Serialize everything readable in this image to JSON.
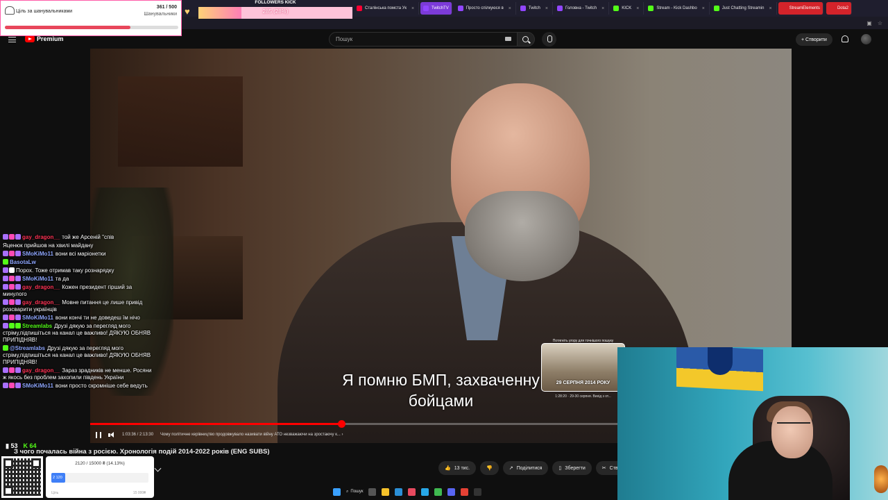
{
  "browser": {
    "tabs": [
      {
        "label": "Сталінська помста Ук",
        "color": "#f03"
      },
      {
        "label": "TwitchTV",
        "color": "#9146ff",
        "style": "badge-purple"
      },
      {
        "label": "Просто спілкуюся в",
        "color": "#9146ff"
      },
      {
        "label": "Twitch",
        "color": "#9146ff"
      },
      {
        "label": "Головна - Twitch",
        "color": "#9146ff"
      },
      {
        "label": "KICK",
        "color": "#53fc18"
      },
      {
        "label": "Stream - Kick Dashbo",
        "color": "#53fc18"
      },
      {
        "label": "Just Chatting Streamin",
        "color": "#53fc18"
      },
      {
        "label": "StreamElements",
        "color": "#d3232a",
        "style": "badge-red"
      },
      {
        "label": "Dota2",
        "color": "#d3232a",
        "style": "badge-red"
      }
    ]
  },
  "header": {
    "logo_text": "Premium",
    "search_placeholder": "Пошук",
    "create_label": "+ Створити"
  },
  "player": {
    "subtitle_line1": "Я помню БМП, захваченну",
    "subtitle_line2": "бойцами",
    "time": "1:03:36 / 2:13:30",
    "chapter": "Чому політичне керівництво продовжувало називати війну АТО незважаючи на зростаючу к... ›",
    "progress_percent": 47.6,
    "preview_hint": "Потягніть угору для точнішого пошуку",
    "preview_overlay": "29 СЕРПНЯ 2014 РОКУ",
    "preview_caption": "1:28:20 · 29-30 серпня. Вихід з от..."
  },
  "video": {
    "title": "З чого почалась війна з росією. Хронологія подій 2014-2022 років (ENG SUBS)",
    "like_count": "13 тис.",
    "share_label": "Поділитися",
    "save_label": "Зберегти",
    "clip_label": "Створи"
  },
  "chat": [
    {
      "user": "gay_dragon__",
      "color": "#ff3355",
      "text": "той же Арсеній \"спів",
      "badges": [
        "#a970ff",
        "#ff49b4",
        "#a970ff"
      ]
    },
    {
      "user": "",
      "color": "#ffffff",
      "text": "Яценюк прийшов на хвилі майдану",
      "badges": []
    },
    {
      "user": "SMoKiMo11",
      "color": "#8fa7ff",
      "text": "вони всі маріонетки",
      "badges": [
        "#a970ff",
        "#ff49b4",
        "#a970ff"
      ]
    },
    {
      "user": "BasotaLw",
      "color": "#8fa7ff",
      "text": "",
      "badges": [
        "#53fc18"
      ]
    },
    {
      "user": "",
      "color": "#3c3cff",
      "text": "Порох. Тоже отримав таку рознарядку",
      "badges": [
        "#a970ff",
        "#ffffff"
      ]
    },
    {
      "user": "SMoKiMo11",
      "color": "#8fa7ff",
      "text": "та да",
      "badges": [
        "#a970ff",
        "#ff49b4",
        "#a970ff"
      ]
    },
    {
      "user": "gay_dragon__",
      "color": "#ff3355",
      "text": "Кожен президент гірший за минулого",
      "badges": [
        "#a970ff",
        "#ff49b4",
        "#a970ff"
      ]
    },
    {
      "user": "gay_dragon__",
      "color": "#ff3355",
      "text": "Мовне питання це лише привід розсварити українців",
      "badges": [
        "#a970ff",
        "#ff49b4",
        "#a970ff"
      ]
    },
    {
      "user": "SMoKiMo11",
      "color": "#8fa7ff",
      "text": "вони кончі ти не доведеш їм нічо",
      "badges": [
        "#a970ff",
        "#ff49b4",
        "#a970ff"
      ]
    },
    {
      "user": "Streamlabs",
      "color": "#53fc18",
      "text": "Друзі дякую за перегляд мого стріму,підпишіться на канал це важливо! ДЯКУЮ ОБНЯВ ПРИПІДНЯВ!",
      "badges": [
        "#a970ff",
        "#53fc18",
        "#53fc18"
      ]
    },
    {
      "user": "@Streamlabs",
      "color": "#8fa7ff",
      "text": "Друзі дякую за перегляд мого стріму,підпишіться на канал це важливо! ДЯКУЮ ОБНЯВ ПРИПІДНЯВ!",
      "badges": [
        "#53fc18"
      ]
    },
    {
      "user": "gay_dragon__",
      "color": "#ff3355",
      "text": "Зараз зрадників не менше. Росяни ж якось без проблем захопили південь України",
      "badges": [
        "#a970ff",
        "#ff49b4",
        "#a970ff"
      ]
    },
    {
      "user": "SMoKiMo11",
      "color": "#8fa7ff",
      "text": "вони просто скромніше себе ведуть",
      "badges": [
        "#a970ff",
        "#ff49b4",
        "#a970ff"
      ]
    }
  ],
  "stats": {
    "twitch_viewers": "53",
    "kick_viewers": "64"
  },
  "follower_goal": {
    "label": "Ціль за шанувальниками",
    "count": "361 / 500",
    "sub": "Шанувальники",
    "percent": 72.2
  },
  "kick_goal": {
    "title": "FOLLOWERS KICK",
    "text": "285 (28%)",
    "percent": 28
  },
  "donation": {
    "text": "2120 / 15000 ₴ (14.13%)",
    "bar_label": "2 120",
    "percent": 14.13,
    "left_label": "Ціль",
    "right_label": "15 000₴"
  }
}
